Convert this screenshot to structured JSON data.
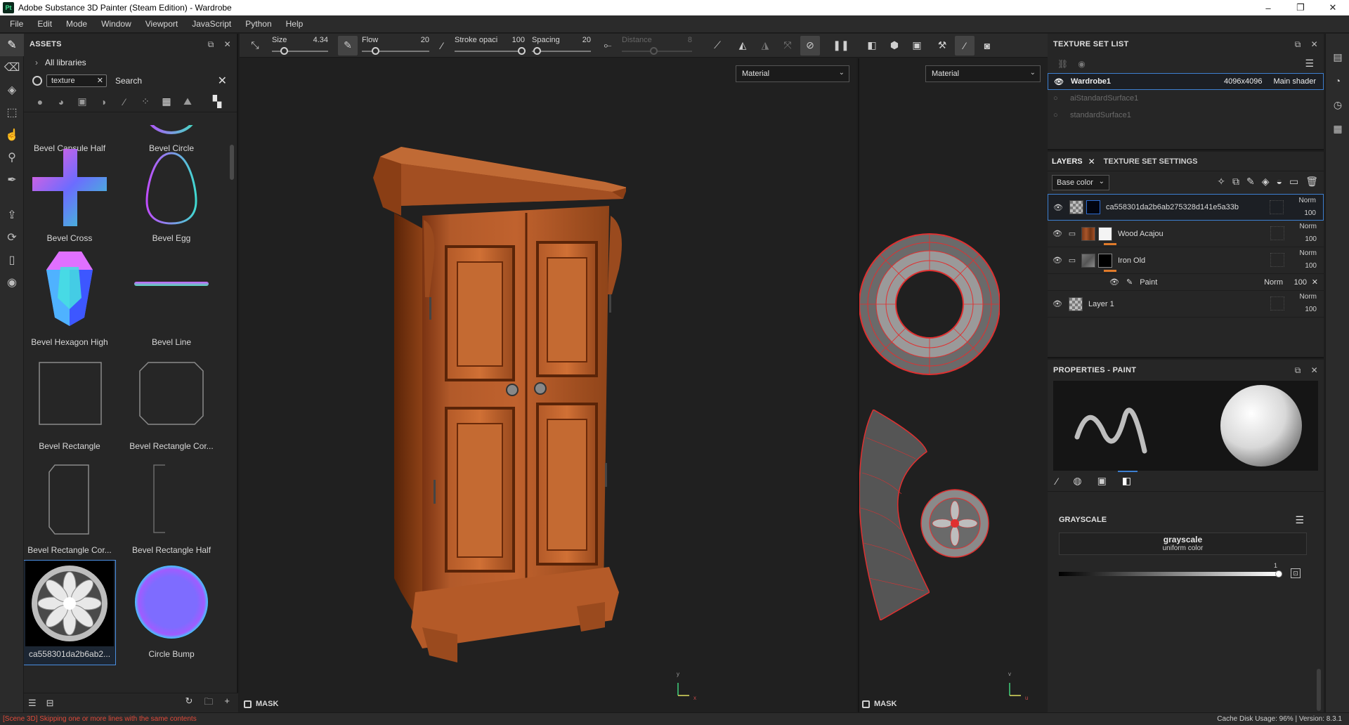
{
  "window": {
    "title": "Adobe Substance 3D Painter (Steam Edition) - Wardrobe",
    "app_icon": "Pt",
    "minimize": "–",
    "maximize": "❐",
    "close": "✕"
  },
  "menu": [
    "File",
    "Edit",
    "Mode",
    "Window",
    "Viewport",
    "JavaScript",
    "Python",
    "Help"
  ],
  "assets": {
    "title": "ASSETS",
    "library": "All libraries",
    "search_chip": "texture",
    "search_placeholder": "Search",
    "items": [
      {
        "label": "Bevel Capsule Half"
      },
      {
        "label": "Bevel Circle"
      },
      {
        "label": "Bevel Cross"
      },
      {
        "label": "Bevel Egg"
      },
      {
        "label": "Bevel Hexagon High"
      },
      {
        "label": "Bevel Line"
      },
      {
        "label": "Bevel Rectangle"
      },
      {
        "label": "Bevel Rectangle Cor..."
      },
      {
        "label": "Bevel Rectangle Cor..."
      },
      {
        "label": "Bevel Rectangle Half"
      },
      {
        "label": "ca558301da2b6ab2..."
      },
      {
        "label": "Circle Bump"
      }
    ]
  },
  "context_bar": {
    "size": {
      "label": "Size",
      "value": "4.34"
    },
    "flow": {
      "label": "Flow",
      "value": "20"
    },
    "stroke_opacity": {
      "label": "Stroke opaci",
      "value": "100"
    },
    "spacing": {
      "label": "Spacing",
      "value": "20"
    },
    "distance": {
      "label": "Distance",
      "value": "8"
    }
  },
  "viewport3d": {
    "dropdown": "Material",
    "mask": "MASK",
    "axis_x": "x",
    "axis_y": "y"
  },
  "viewport2d": {
    "dropdown": "Material",
    "mask": "MASK",
    "axis_u": "u",
    "axis_v": "v"
  },
  "texture_set_list": {
    "title": "TEXTURE SET LIST",
    "rows": [
      {
        "name": "Wardrobe1",
        "resolution": "4096x4096",
        "shader": "Main shader"
      },
      {
        "name": "aiStandardSurface1"
      },
      {
        "name": "standardSurface1"
      }
    ]
  },
  "layers": {
    "tab_layers": "LAYERS",
    "tab_settings": "TEXTURE SET SETTINGS",
    "channel": "Base color",
    "items": [
      {
        "name": "ca558301da2b6ab275328d141e5a33b",
        "blend": "Norm",
        "opacity": "100"
      },
      {
        "name": "Wood Acajou",
        "blend": "Norm",
        "opacity": "100"
      },
      {
        "name": "Iron Old",
        "blend": "Norm",
        "opacity": "100"
      },
      {
        "name": "Layer 1",
        "blend": "Norm",
        "opacity": "100"
      }
    ],
    "sub": {
      "name": "Paint",
      "blend": "Norm",
      "opacity": "100"
    }
  },
  "properties": {
    "title": "PROPERTIES - PAINT",
    "section": "GRAYSCALE",
    "resource_name": "grayscale",
    "resource_desc": "uniform color",
    "slider_max": "1",
    "level": 1.0
  },
  "status": {
    "message": "[Scene 3D] Skipping one or more lines with the same contents",
    "cache": "Cache Disk Usage:   96%  |  Version: 8.3.1"
  }
}
